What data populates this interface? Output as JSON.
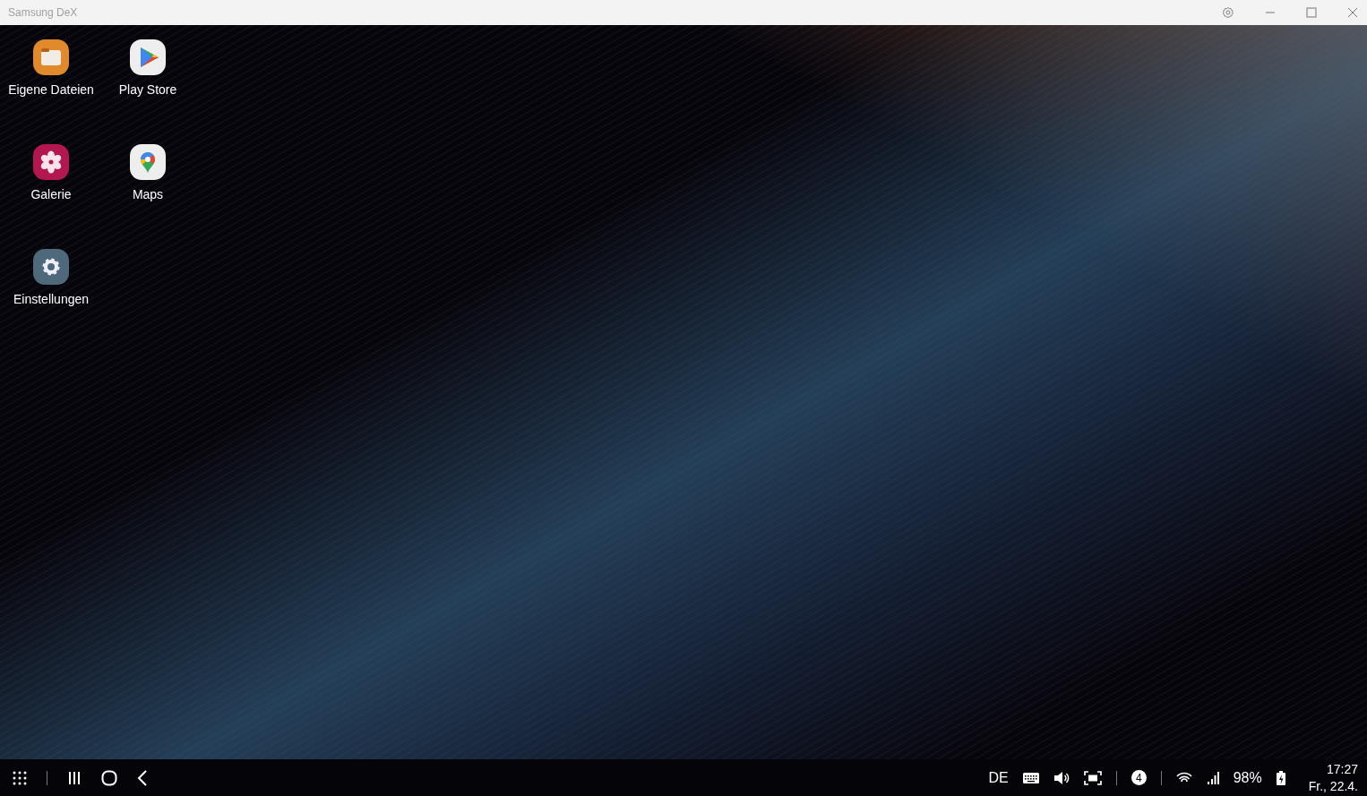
{
  "window": {
    "title": "Samsung DeX"
  },
  "desktop_apps": [
    {
      "label": "Eigene Dateien",
      "kind": "folder"
    },
    {
      "label": "Play Store",
      "kind": "store"
    },
    {
      "label": "Galerie",
      "kind": "gallery"
    },
    {
      "label": "Maps",
      "kind": "maps"
    },
    {
      "label": "Einstellungen",
      "kind": "settings"
    }
  ],
  "taskbar": {
    "language": "DE",
    "notification_count": "4",
    "battery": "98%",
    "time": "17:27",
    "date": "Fr., 22.4."
  }
}
